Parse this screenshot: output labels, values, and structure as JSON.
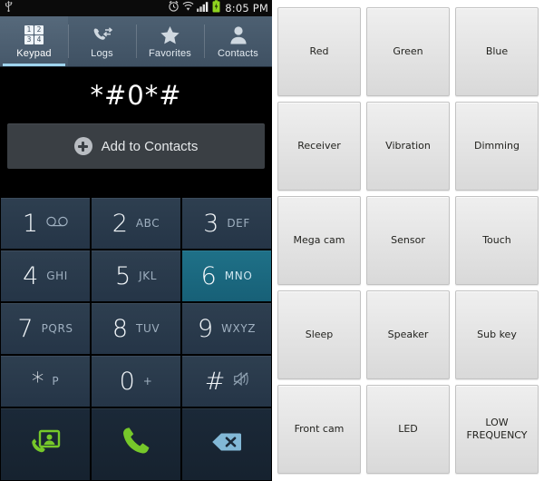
{
  "statusbar": {
    "usb_icon": "usb-icon",
    "alarm_icon": "alarm-clock-icon",
    "wifi_icon": "wifi-icon",
    "signal_icon": "signal-bars-icon",
    "battery_icon": "battery-charging-icon",
    "clock": "8:05 PM",
    "battery_color": "#8fd41f",
    "text_color": "#e9e9e9"
  },
  "tabs": [
    {
      "label": "Keypad",
      "icon": "keypad-grid-icon",
      "active": true
    },
    {
      "label": "Logs",
      "icon": "call-log-icon",
      "active": false
    },
    {
      "label": "Favorites",
      "icon": "star-icon",
      "active": false
    },
    {
      "label": "Contacts",
      "icon": "person-icon",
      "active": false
    }
  ],
  "display": {
    "number": "*#0*#"
  },
  "add_contacts": {
    "label": "Add to Contacts",
    "icon": "plus-circle-icon"
  },
  "keypad": {
    "highlight_color": "#1a6b80",
    "keys": [
      {
        "digit": "1",
        "sub": "",
        "icon": "voicemail-icon",
        "pressed": false
      },
      {
        "digit": "2",
        "sub": "ABC",
        "icon": "",
        "pressed": false
      },
      {
        "digit": "3",
        "sub": "DEF",
        "icon": "",
        "pressed": false
      },
      {
        "digit": "4",
        "sub": "GHI",
        "icon": "",
        "pressed": false
      },
      {
        "digit": "5",
        "sub": "JKL",
        "icon": "",
        "pressed": false
      },
      {
        "digit": "6",
        "sub": "MNO",
        "icon": "",
        "pressed": true
      },
      {
        "digit": "7",
        "sub": "PQRS",
        "icon": "",
        "pressed": false
      },
      {
        "digit": "8",
        "sub": "TUV",
        "icon": "",
        "pressed": false
      },
      {
        "digit": "9",
        "sub": "WXYZ",
        "icon": "",
        "pressed": false
      },
      {
        "digit": "*",
        "sub": "P",
        "icon": "",
        "pressed": false
      },
      {
        "digit": "0",
        "sub": "+",
        "icon": "",
        "pressed": false
      },
      {
        "digit": "#",
        "sub": "",
        "icon": "mute-icon",
        "pressed": false
      }
    ],
    "actions": [
      {
        "icon": "video-call-contact-icon",
        "color": "#76c82a"
      },
      {
        "icon": "call-icon",
        "color": "#76c82a"
      },
      {
        "icon": "backspace-icon",
        "color": "#82b8d6"
      }
    ]
  },
  "test_panel": {
    "tiles": [
      "Red",
      "Green",
      "Blue",
      "Receiver",
      "Vibration",
      "Dimming",
      "Mega cam",
      "Sensor",
      "Touch",
      "Sleep",
      "Speaker",
      "Sub key",
      "Front cam",
      "LED",
      "LOW\nFREQUENCY"
    ]
  }
}
